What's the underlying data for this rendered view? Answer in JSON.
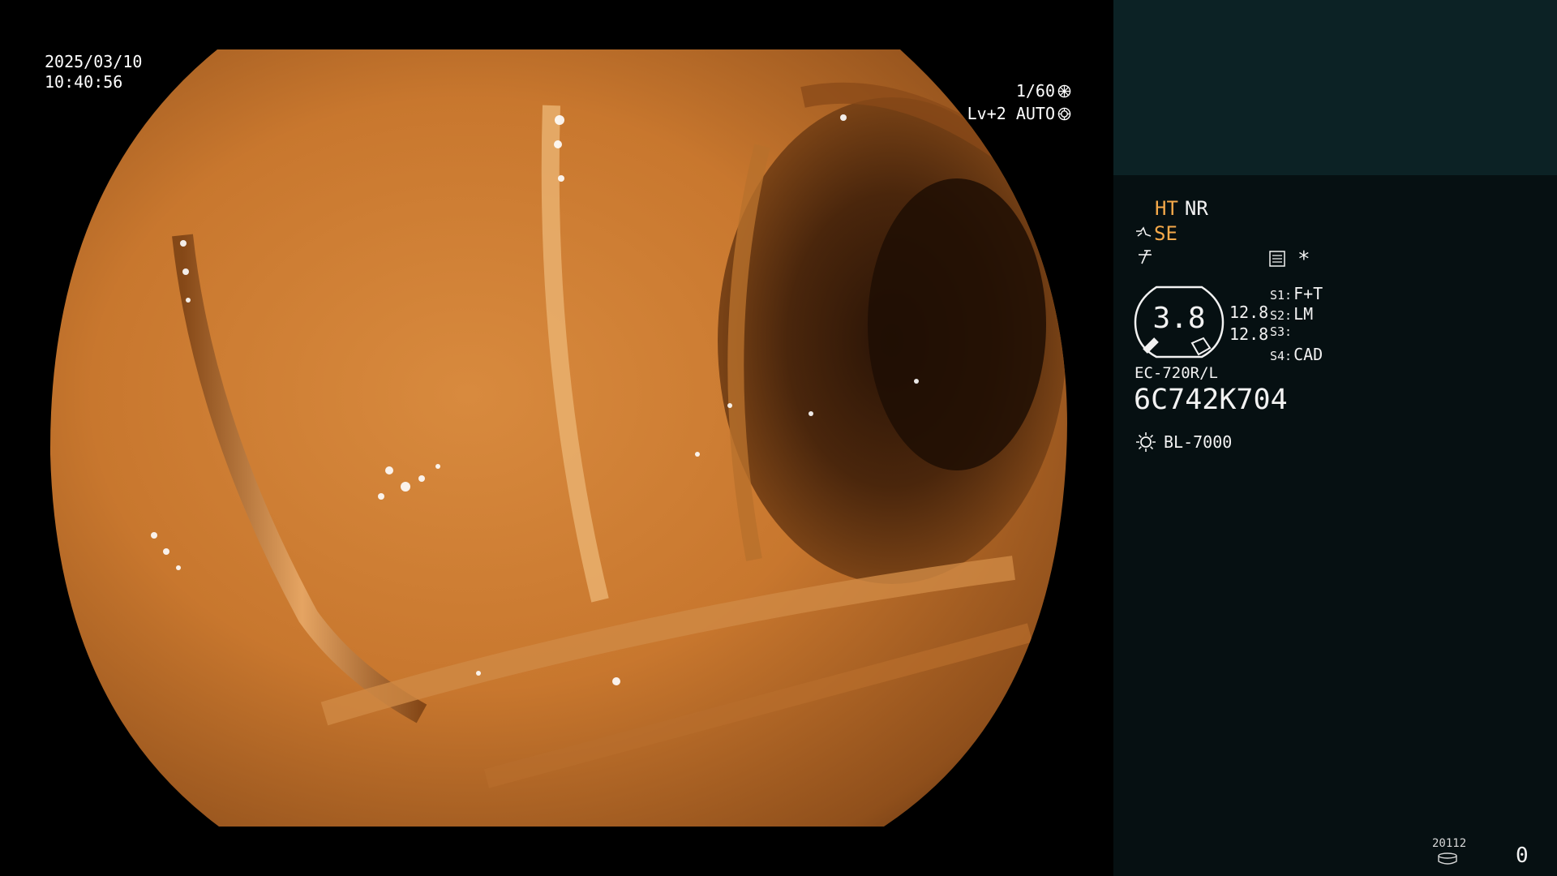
{
  "overlay": {
    "date": "2025/03/10",
    "time": "10:40:56",
    "shutter": "1/60",
    "shutter_icon": "shutter-icon",
    "level": "Lv+2 AUTO",
    "iris_icon": "iris-icon"
  },
  "panel": {
    "mode_ht": "HT",
    "mode_nr": "NR",
    "mode_se": "SE",
    "star": "*",
    "gauge_value": "3.8",
    "value_top": "12.8",
    "value_bottom": "12.8",
    "s_settings": [
      {
        "key": "S1:",
        "value": "F+T"
      },
      {
        "key": "S2:",
        "value": "LM"
      },
      {
        "key": "S3:",
        "value": ""
      },
      {
        "key": "S4:",
        "value": "CAD"
      }
    ],
    "scope_model": "EC-720R/L",
    "scope_serial": "6C742K704",
    "light_source": "BL-7000",
    "counter_label": "20112",
    "counter_value": "0"
  },
  "colors": {
    "panel_background": "#061012",
    "thumbnail_background": "#0c2225",
    "highlight_orange": "#f5a94a",
    "text_white": "#f2f2f2"
  }
}
